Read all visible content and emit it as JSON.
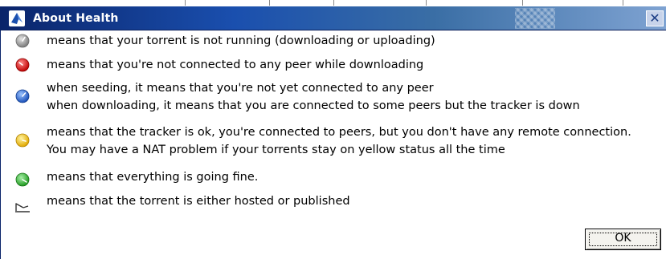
{
  "dialog": {
    "title": "About Health",
    "close_glyph": "✕"
  },
  "legend": [
    {
      "icon": "grey-status-icon",
      "color": "#8c8c8c",
      "lines": [
        "means that your torrent is not running (downloading or uploading)"
      ]
    },
    {
      "icon": "red-status-icon",
      "color": "#e02020",
      "lines": [
        "means that you're not connected to any peer while downloading"
      ]
    },
    {
      "icon": "blue-status-icon",
      "color": "#2f6fd6",
      "lines": [
        "when seeding, it means that you're not yet connected to any peer",
        "when downloading, it means that you are connected to some peers but the tracker is down"
      ]
    },
    {
      "icon": "yellow-status-icon",
      "color": "#f2cc1c",
      "lines": [
        "means that the tracker is ok, you're connected to peers, but you don't have any remote connection.",
        "You may have a NAT problem if your torrents stay on yellow status all the time"
      ]
    },
    {
      "icon": "green-status-icon",
      "color": "#2fb82f",
      "lines": [
        "means that everything is going fine."
      ]
    },
    {
      "icon": "hosted-published-icon",
      "color": "#444444",
      "lines": [
        "means that the torrent is either hosted or published"
      ]
    }
  ],
  "buttons": {
    "ok_label": "OK"
  }
}
